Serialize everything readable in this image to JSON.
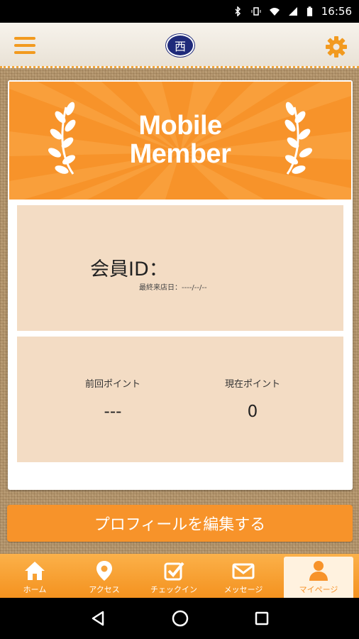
{
  "status_bar": {
    "time": "16:56"
  },
  "app_bar": {
    "logo_text": "西"
  },
  "banner": {
    "title_line1": "Mobile",
    "title_line2": "Member"
  },
  "member": {
    "id_label": "会員ID：",
    "last_visit": "最終来店日：----/--/--"
  },
  "points": {
    "previous_label": "前回ポイント",
    "previous_value": "---",
    "current_label": "現在ポイント",
    "current_value": "0"
  },
  "edit_profile_label": "プロフィールを編集する",
  "tabs": [
    {
      "label": "ホーム",
      "icon": "home-icon"
    },
    {
      "label": "アクセス",
      "icon": "map-pin-icon"
    },
    {
      "label": "チェックイン",
      "icon": "checkbox-icon"
    },
    {
      "label": "メッセージ",
      "icon": "envelope-icon"
    },
    {
      "label": "マイページ",
      "icon": "person-icon"
    }
  ],
  "colors": {
    "accent": "#f7932a",
    "panel": "#f3dcc4"
  }
}
